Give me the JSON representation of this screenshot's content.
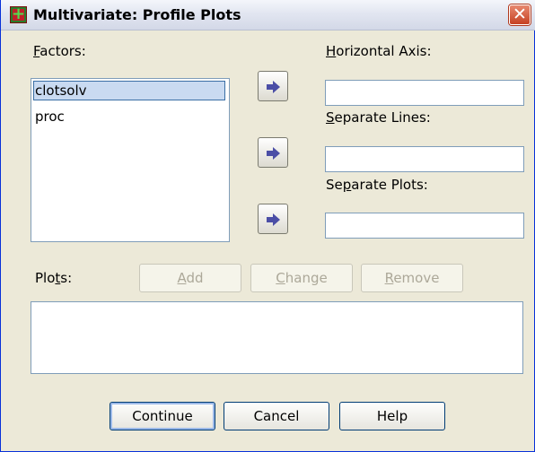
{
  "window": {
    "title": "Multivariate: Profile Plots",
    "close_label": "✕"
  },
  "factors": {
    "label_first": "F",
    "label_rest": "actors:",
    "items": [
      "clotsolv",
      "proc"
    ],
    "selected_index": 0
  },
  "horizontal_axis": {
    "label_first": "H",
    "label_rest": "orizontal Axis:",
    "value": ""
  },
  "separate_lines": {
    "label_first": "S",
    "label_rest": "eparate Lines:",
    "value": ""
  },
  "separate_plots": {
    "label_pre": "Se",
    "label_key": "p",
    "label_post": "arate Plots:",
    "value": ""
  },
  "plots": {
    "label_pre": "Plo",
    "label_key": "t",
    "label_post": "s:",
    "items": []
  },
  "buttons": {
    "add_first": "A",
    "add_rest": "dd",
    "change_first": "C",
    "change_rest": "hange",
    "remove_first": "R",
    "remove_rest": "emove",
    "continue": "Continue",
    "cancel": "Cancel",
    "help": "Help"
  },
  "icons": {
    "move_arrow": "right-arrow-icon",
    "app": "spss-app-icon",
    "close": "close-icon"
  },
  "colors": {
    "arrow": "#4b4ea6",
    "selection": "#c9daf1",
    "dialog_bg": "#ece9d8"
  }
}
